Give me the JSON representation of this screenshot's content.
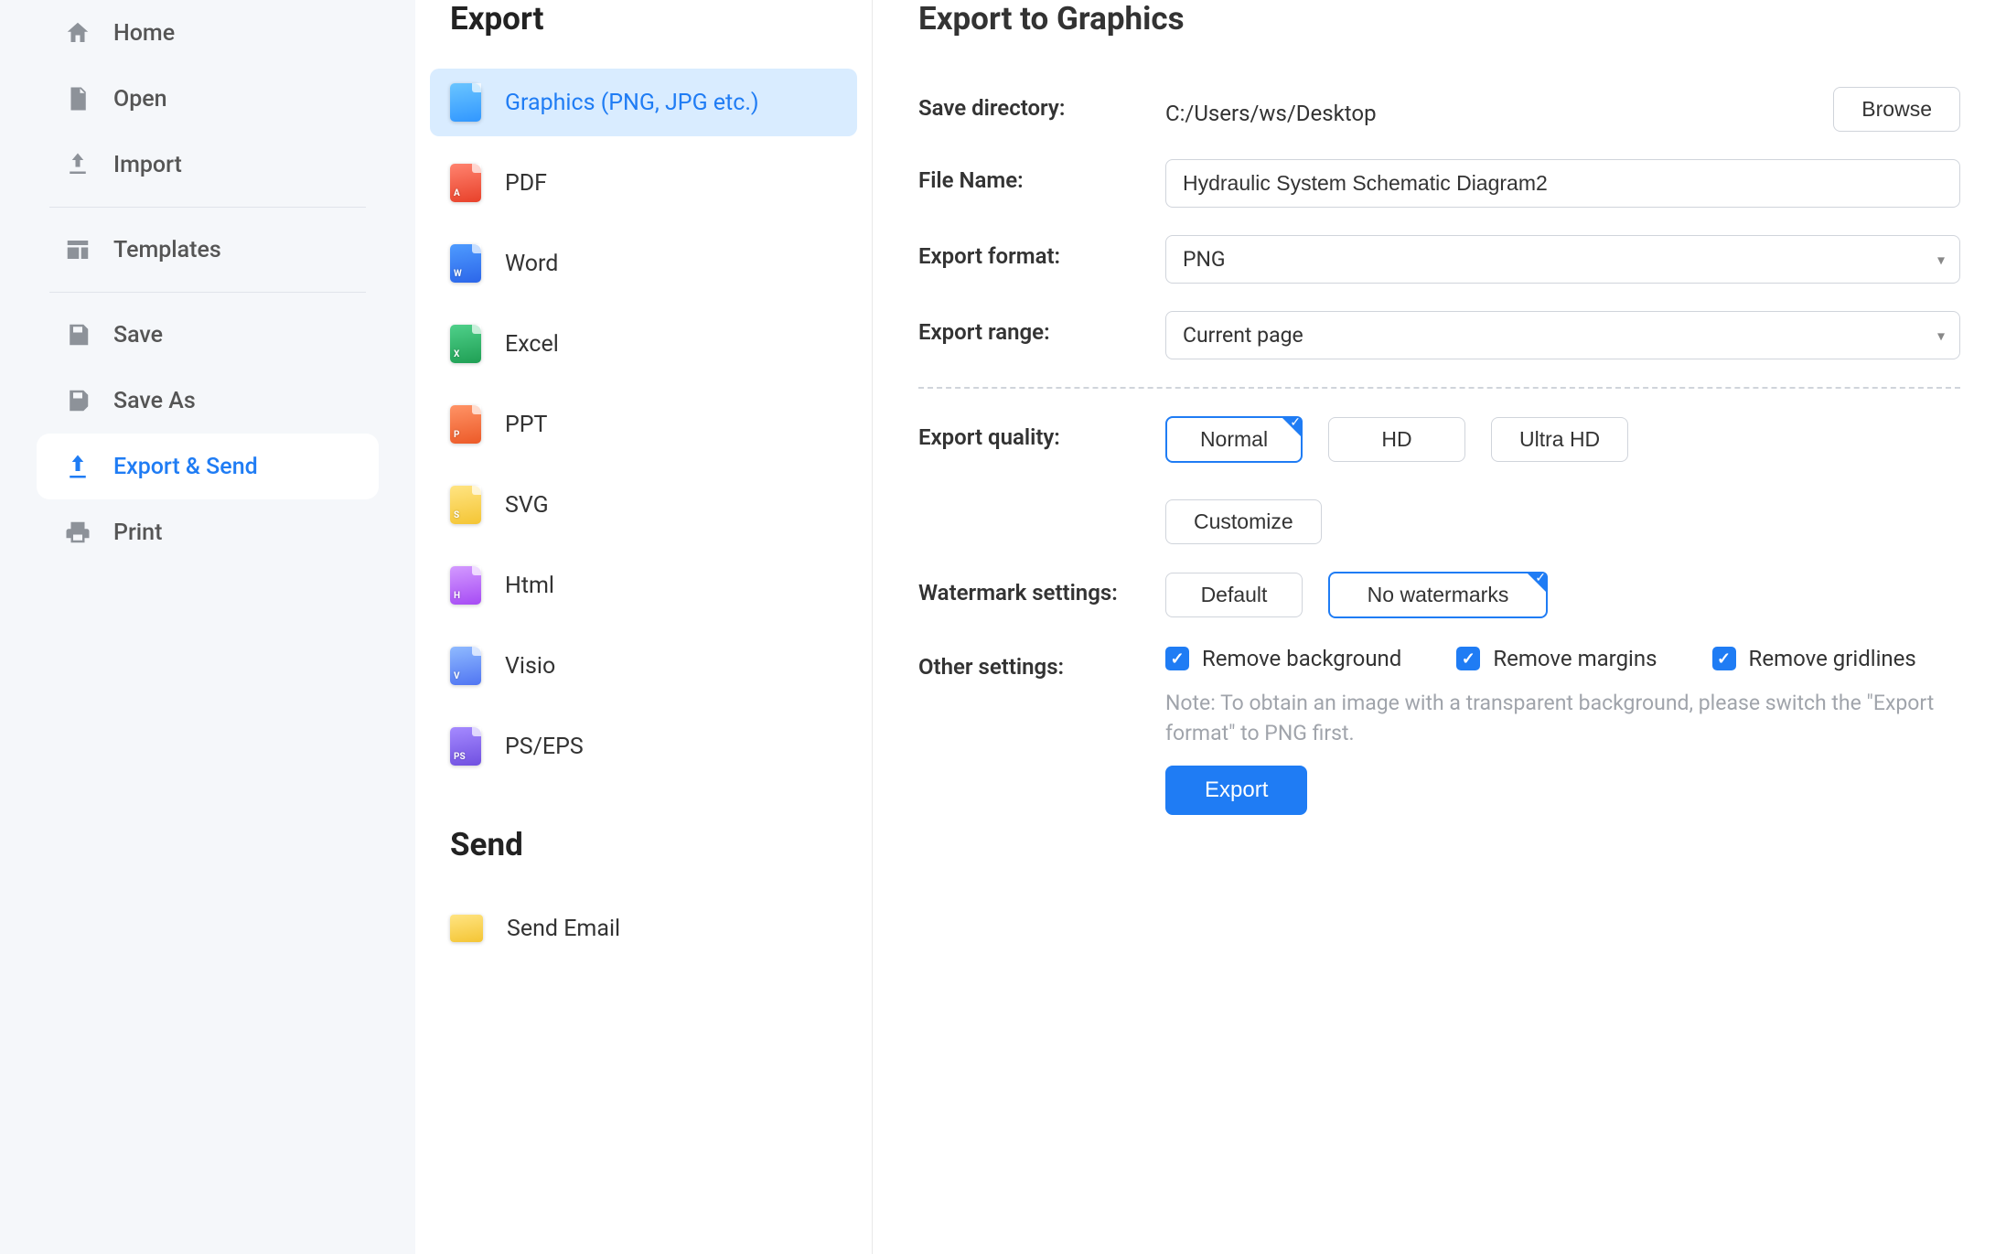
{
  "sidebar": {
    "items": [
      {
        "label": "Home"
      },
      {
        "label": "Open"
      },
      {
        "label": "Import"
      },
      {
        "label": "Templates"
      },
      {
        "label": "Save"
      },
      {
        "label": "Save As"
      },
      {
        "label": "Export & Send"
      },
      {
        "label": "Print"
      }
    ]
  },
  "export_list": {
    "heading_export": "Export",
    "heading_send": "Send",
    "formats": {
      "graphics": "Graphics (PNG, JPG etc.)",
      "pdf": "PDF",
      "word": "Word",
      "excel": "Excel",
      "ppt": "PPT",
      "svg": "SVG",
      "html": "Html",
      "visio": "Visio",
      "ps": "PS/EPS"
    },
    "send_email": "Send Email",
    "tags": {
      "pdf": "A",
      "word": "W",
      "excel": "X",
      "ppt": "P",
      "svg": "S",
      "html": "H",
      "visio": "V",
      "ps": "PS"
    }
  },
  "panel": {
    "title": "Export to Graphics",
    "labels": {
      "save_dir": "Save directory:",
      "file_name": "File Name:",
      "export_format": "Export format:",
      "export_range": "Export range:",
      "export_quality": "Export quality:",
      "watermark": "Watermark settings:",
      "other": "Other settings:"
    },
    "values": {
      "save_dir": "C:/Users/ws/Desktop",
      "file_name": "Hydraulic System Schematic Diagram2",
      "export_format": "PNG",
      "export_range": "Current page"
    },
    "buttons": {
      "browse": "Browse",
      "normal": "Normal",
      "hd": "HD",
      "ultra_hd": "Ultra HD",
      "customize": "Customize",
      "wm_default": "Default",
      "wm_none": "No watermarks",
      "export": "Export"
    },
    "checkboxes": {
      "remove_bg": "Remove background",
      "remove_margins": "Remove margins",
      "remove_gridlines": "Remove gridlines"
    },
    "note": "Note: To obtain an image with a transparent background, please switch the \"Export format\" to PNG first."
  }
}
